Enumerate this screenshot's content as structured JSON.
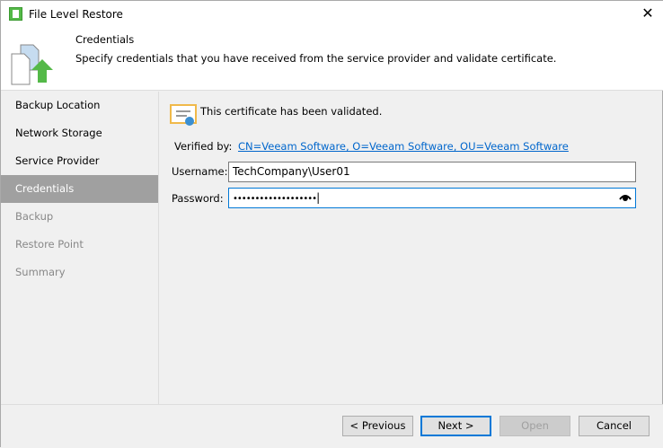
{
  "window": {
    "title": "File Level Restore"
  },
  "header": {
    "title": "Credentials",
    "description": "Specify credentials that you have received from the service provider and validate certificate."
  },
  "sidebar": {
    "items": [
      {
        "label": "Backup Location",
        "state": "normal"
      },
      {
        "label": "Network Storage",
        "state": "normal"
      },
      {
        "label": "Service Provider",
        "state": "normal"
      },
      {
        "label": "Credentials",
        "state": "active"
      },
      {
        "label": "Backup",
        "state": "disabled"
      },
      {
        "label": "Restore Point",
        "state": "disabled"
      },
      {
        "label": "Summary",
        "state": "disabled"
      }
    ]
  },
  "main": {
    "cert_status": "This certificate has been validated.",
    "verified_by_label": "Verified by:",
    "verified_by_value": "CN=Veeam Software, O=Veeam Software, OU=Veeam Software",
    "username_label": "Username:",
    "username_value": "TechCompany\\User01",
    "password_label": "Password:",
    "password_value": "•••••••••••••••••••"
  },
  "footer": {
    "previous": "< Previous",
    "next": "Next >",
    "open": "Open",
    "cancel": "Cancel"
  }
}
